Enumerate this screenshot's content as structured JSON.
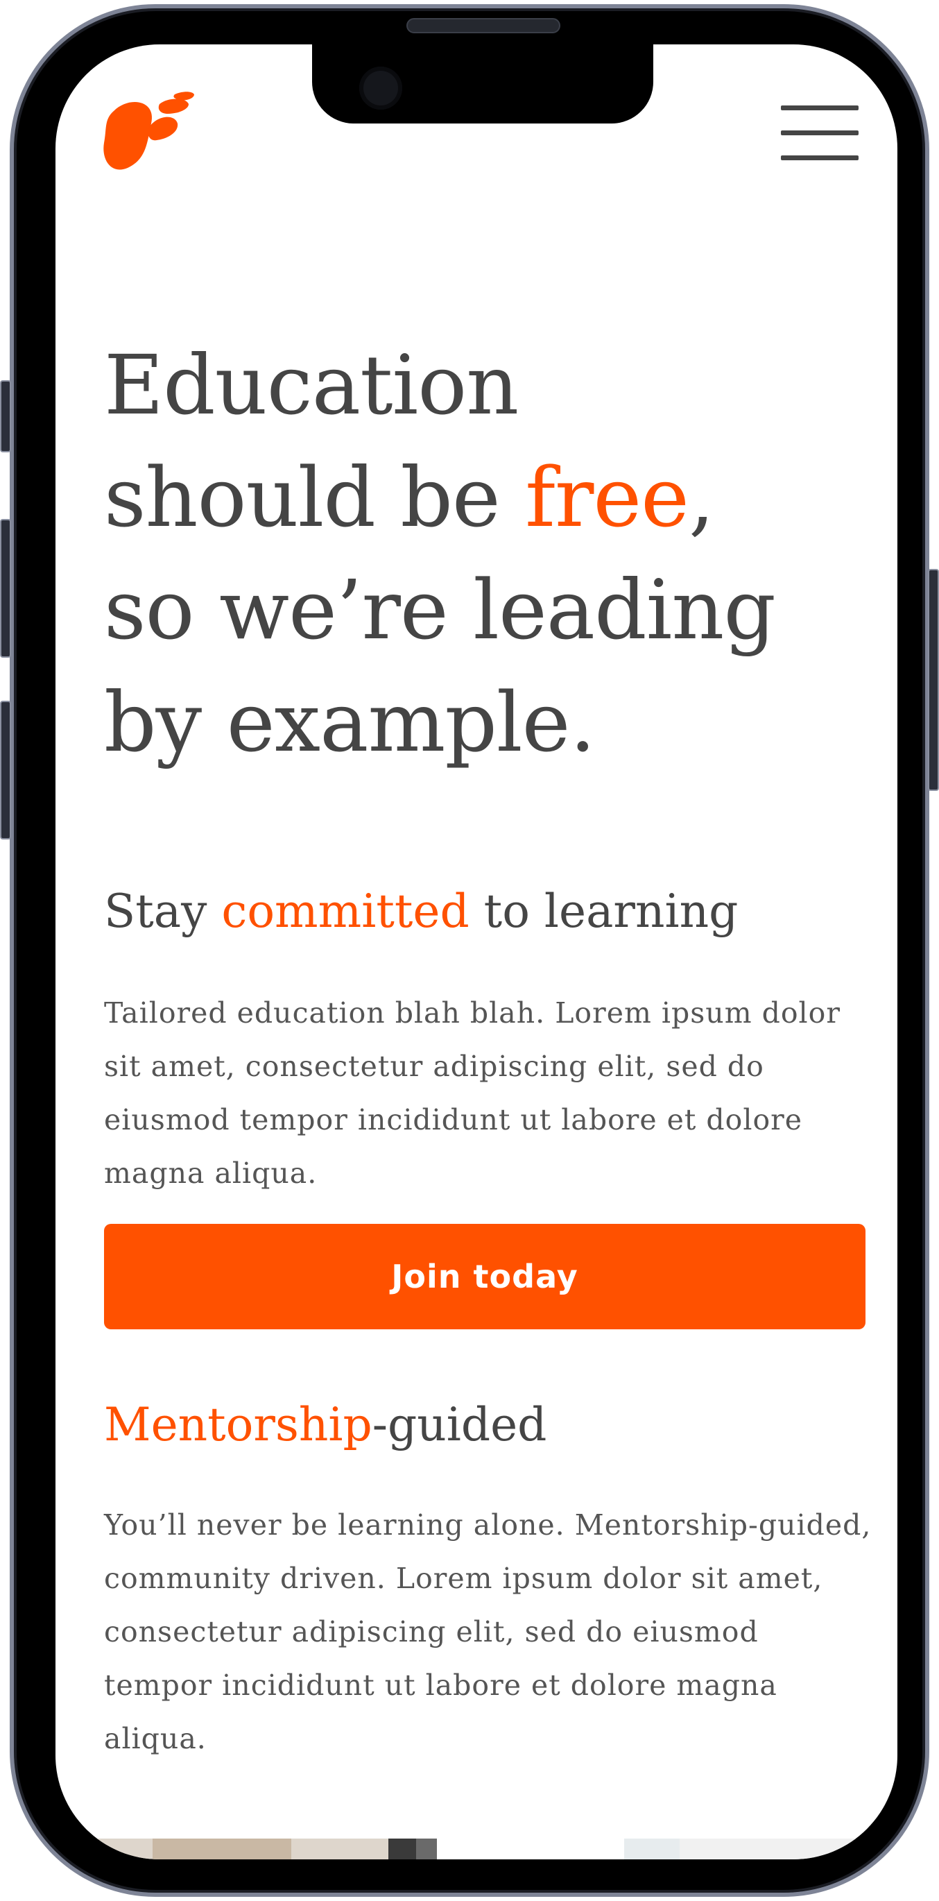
{
  "brand": {
    "logo_icon": "brand-logo-icon",
    "accent_color": "#ff5100",
    "text_color": "#454545"
  },
  "header": {
    "menu_icon": "hamburger-menu-icon"
  },
  "hero": {
    "line_1": "Education",
    "line_2_before": "should be ",
    "line_2_accent": "free",
    "line_2_after": ",",
    "line_3": "so we’re leading",
    "line_4": "by example."
  },
  "section_commitment": {
    "title_before": "Stay ",
    "title_accent": "committed",
    "title_after": " to learning",
    "body": "Tailored education blah blah. Lorem ipsum dolor sit amet, consectetur adipiscing elit, sed do eiusmod tempor incididunt ut labore et dolore magna aliqua.",
    "cta_label": "Join today"
  },
  "section_mentorship": {
    "title_accent": "Mentorship",
    "title_after": "-guided",
    "body": "You’ll never be learning alone. Mentorship-guided, community driven. Lorem ipsum dolor sit amet, consectetur adipiscing elit, sed do eiusmod tempor incididunt ut labore et dolore magna aliqua."
  }
}
